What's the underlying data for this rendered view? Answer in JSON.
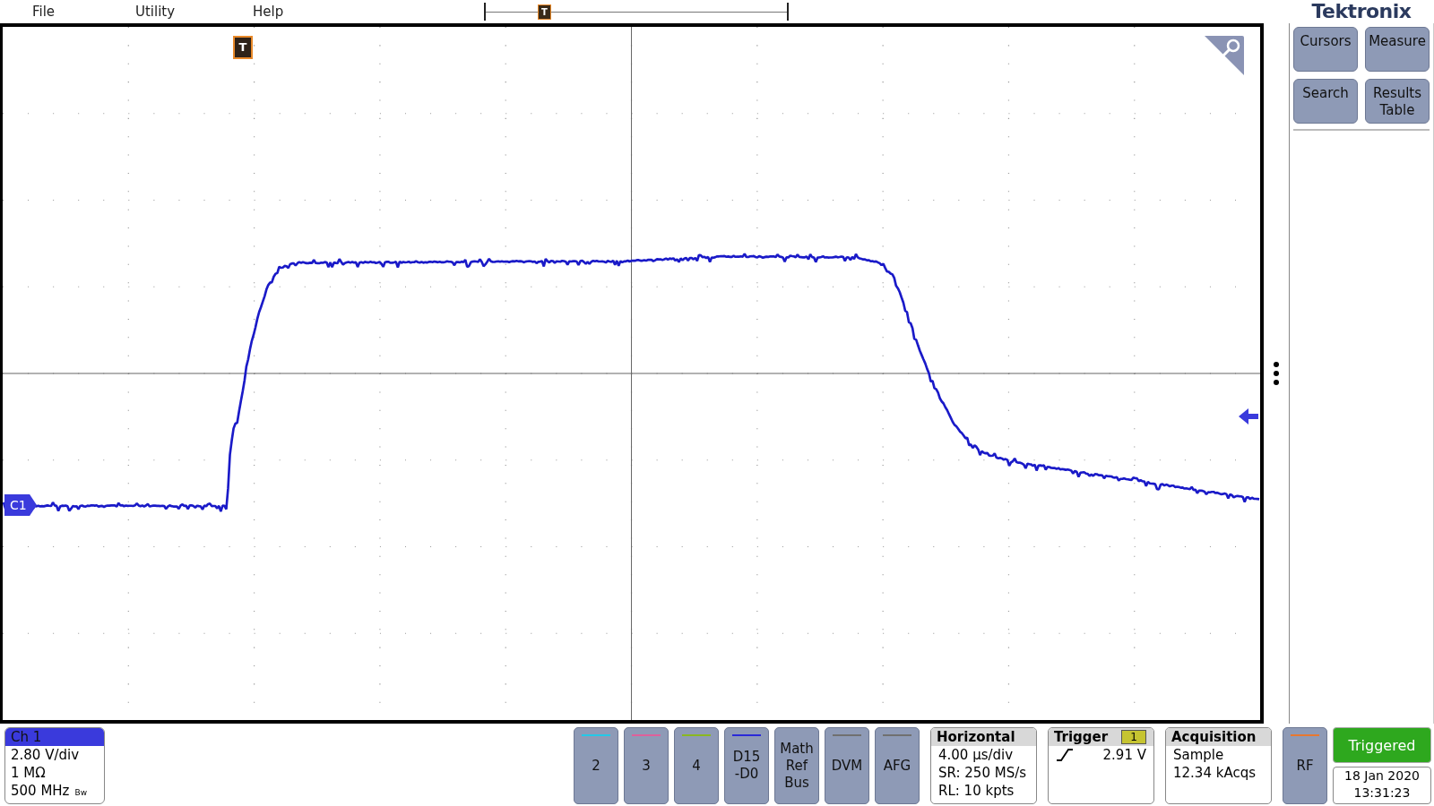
{
  "menu": [
    {
      "label": "File"
    },
    {
      "label": "Utility"
    },
    {
      "label": "Help"
    }
  ],
  "overview_marker": "T",
  "trigger_marker": "T",
  "channel_marker": "C1",
  "brand": "Tektronix",
  "side_buttons": [
    {
      "label": "Cursors"
    },
    {
      "label": "Measure"
    },
    {
      "label": "Search"
    },
    {
      "label": "Results Table"
    }
  ],
  "channel_badge": {
    "title": "Ch 1",
    "lines": [
      "2.80 V/div",
      "1 MΩ",
      "500 MHz"
    ],
    "bandwidth_mark": "Bw"
  },
  "channel_buttons": [
    {
      "lines": [
        "2"
      ],
      "color": "#22c8e8"
    },
    {
      "lines": [
        "3"
      ],
      "color": "#e0609a"
    },
    {
      "lines": [
        "4"
      ],
      "color": "#8ab820"
    },
    {
      "lines": [
        "D15",
        "-D0"
      ],
      "color": "#2a2ad8"
    },
    {
      "lines": [
        "Math",
        "Ref",
        "Bus"
      ]
    },
    {
      "lines": [
        "DVM"
      ],
      "color": "#707070"
    },
    {
      "lines": [
        "AFG"
      ],
      "color": "#707070"
    }
  ],
  "horizontal": {
    "title": "Horizontal",
    "lines": [
      "4.00 µs/div",
      "SR: 250 MS/s",
      "RL: 10 kpts"
    ]
  },
  "trigger": {
    "title": "Trigger",
    "source": "1",
    "level": "2.91 V"
  },
  "acquisition": {
    "title": "Acquisition",
    "lines": [
      "Sample",
      "12.34 kAcqs"
    ]
  },
  "rf_button": {
    "label": "RF",
    "color": "#e87830"
  },
  "status": {
    "label": "Triggered",
    "date": "18 Jan 2020",
    "time": "13:31:23"
  }
}
